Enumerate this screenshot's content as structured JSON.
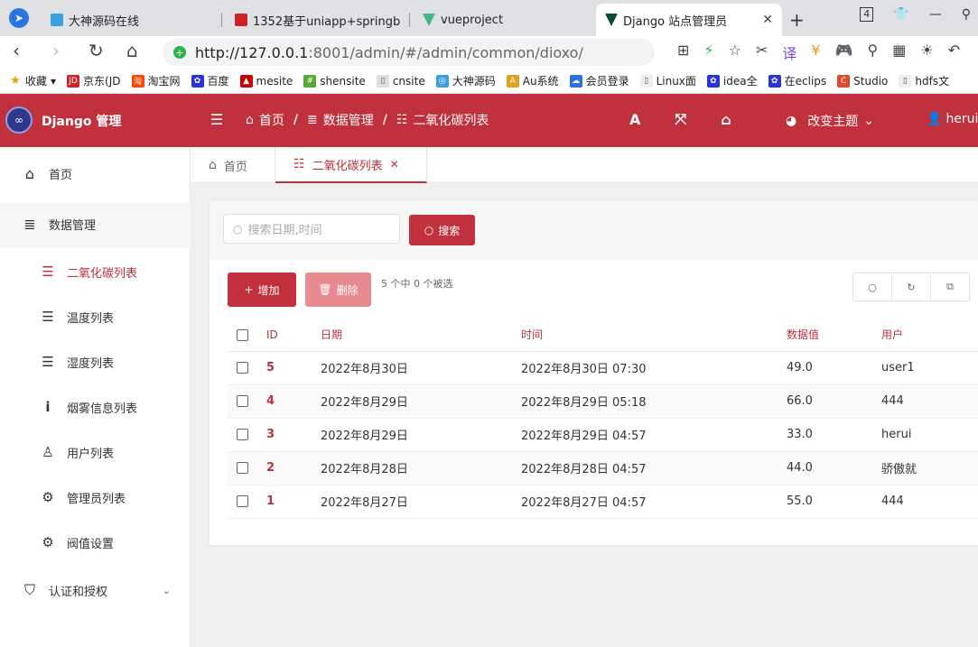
{
  "browser": {
    "tabs": [
      {
        "title": "大神源码在线"
      },
      {
        "title": "1352基于uniapp+springb"
      },
      {
        "title": "vueproject"
      },
      {
        "title": "Django 站点管理员"
      }
    ],
    "tab_count": "4",
    "url_host": "http://127.0.0.1",
    "url_path": ":8001/admin/#/admin/common/dioxo/",
    "bookmarks": [
      "收藏",
      "京东(JD",
      "淘宝网",
      "百度",
      "mesite",
      "shensite",
      "cnsite",
      "大神源码",
      "Au系统",
      "会员登录",
      "Linux面",
      "idea全",
      "在eclips",
      "Studio",
      "hdfs文"
    ]
  },
  "app": {
    "title": "Django 管理",
    "breadcrumb": [
      "首页",
      "数据管理",
      "二氧化碳列表"
    ],
    "theme_label": "改变主题",
    "user_name": "herui"
  },
  "sidebar": {
    "home": "首页",
    "data_mgmt": "数据管理",
    "items": [
      "二氧化碳列表",
      "温度列表",
      "湿度列表",
      "烟雾信息列表",
      "用户列表",
      "管理员列表",
      "阀值设置"
    ],
    "auth": "认证和授权"
  },
  "page_tabs": [
    {
      "label": "首页"
    },
    {
      "label": "二氧化碳列表"
    }
  ],
  "toolbar": {
    "search_placeholder": "搜索日期,时间",
    "search_label": "搜索",
    "add_label": "增加",
    "delete_label": "删除",
    "selection_text": "5 个中 0 个被选"
  },
  "table": {
    "columns": [
      "ID",
      "日期",
      "时间",
      "数据值",
      "用户"
    ],
    "rows": [
      {
        "id": "5",
        "date": "2022年8月30日",
        "time": "2022年8月30日 07:30",
        "value": "49.0",
        "user": "user1"
      },
      {
        "id": "4",
        "date": "2022年8月29日",
        "time": "2022年8月29日 05:18",
        "value": "66.0",
        "user": "444"
      },
      {
        "id": "3",
        "date": "2022年8月29日",
        "time": "2022年8月29日 04:57",
        "value": "33.0",
        "user": "herui"
      },
      {
        "id": "2",
        "date": "2022年8月28日",
        "time": "2022年8月28日 04:57",
        "value": "44.0",
        "user": "骄傲就"
      },
      {
        "id": "1",
        "date": "2022年8月27日",
        "time": "2022年8月27日 04:57",
        "value": "55.0",
        "user": "444"
      }
    ]
  },
  "colors": {
    "primary": "#c0303d",
    "primary_light": "#e88a8f"
  }
}
